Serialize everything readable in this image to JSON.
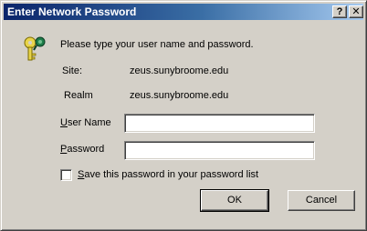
{
  "window": {
    "title": "Enter Network Password",
    "help_glyph": "?",
    "close_glyph": "✕"
  },
  "dialog": {
    "prompt": "Please type your user name and password.",
    "site_label": "Site:",
    "site_value": "zeus.sunybroome.edu",
    "realm_label": "Realm",
    "realm_value": "zeus.sunybroome.edu",
    "username_label_u": "U",
    "username_label_rest": "ser Name",
    "username_value": "",
    "password_label_u": "P",
    "password_label_rest": "assword",
    "password_value": "",
    "save_label_u": "S",
    "save_label_rest": "ave this password in your password list",
    "save_checked": false
  },
  "buttons": {
    "ok": "OK",
    "cancel": "Cancel"
  },
  "icons": {
    "dialog_icon": "keys-icon"
  }
}
